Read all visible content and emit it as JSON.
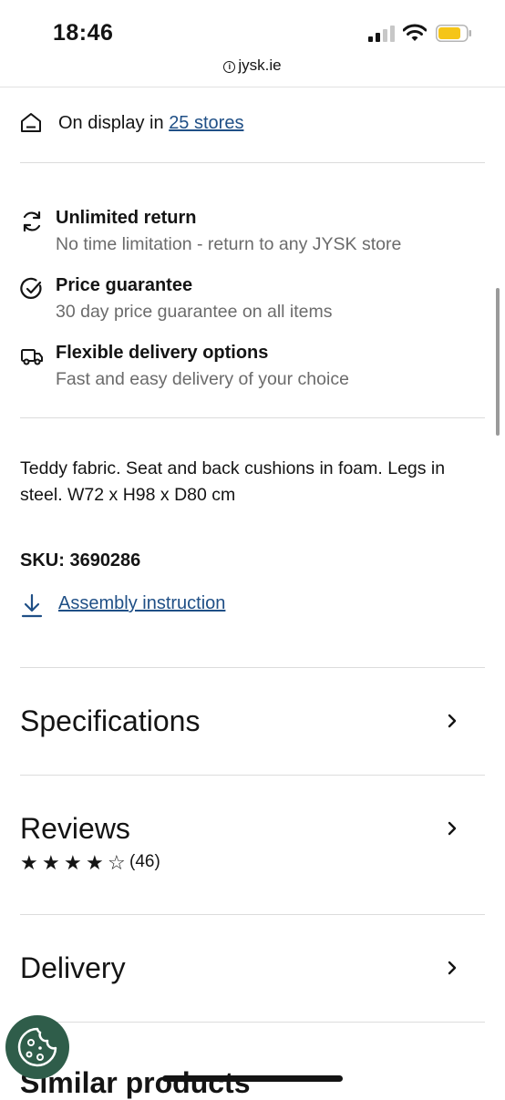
{
  "status_bar": {
    "time": "18:46",
    "icons": [
      "signal-icon",
      "wifi-icon",
      "battery-icon"
    ],
    "battery_color": "#f5c518"
  },
  "browser": {
    "url": "jysk.ie"
  },
  "store": {
    "prefix": "On display in",
    "link_text": "25 stores",
    "icon": "store-icon"
  },
  "usps": [
    {
      "icon": "return-icon",
      "title": "Unlimited return",
      "subtitle": "No time limitation - return to any JYSK store"
    },
    {
      "icon": "check-circle-icon",
      "title": "Price guarantee",
      "subtitle": "30 day price guarantee on all items"
    },
    {
      "icon": "truck-icon",
      "title": "Flexible delivery options",
      "subtitle": "Fast and easy delivery of your choice"
    }
  ],
  "description": "Teddy fabric. Seat and back cushions in foam. Legs in steel. W72 x H98 x D80 cm",
  "sku": "SKU: 3690286",
  "assembly": {
    "label": "Assembly instruction",
    "icon": "download-icon"
  },
  "accordions": {
    "specifications": "Specifications",
    "reviews": "Reviews",
    "delivery": "Delivery"
  },
  "reviews": {
    "rating": 4,
    "max": 5,
    "count": "(46)"
  },
  "similar_heading": "Similar products",
  "colors": {
    "link": "#1f4f86",
    "cookie_button": "#2f5d4a",
    "muted_text": "#6b6b6b"
  }
}
